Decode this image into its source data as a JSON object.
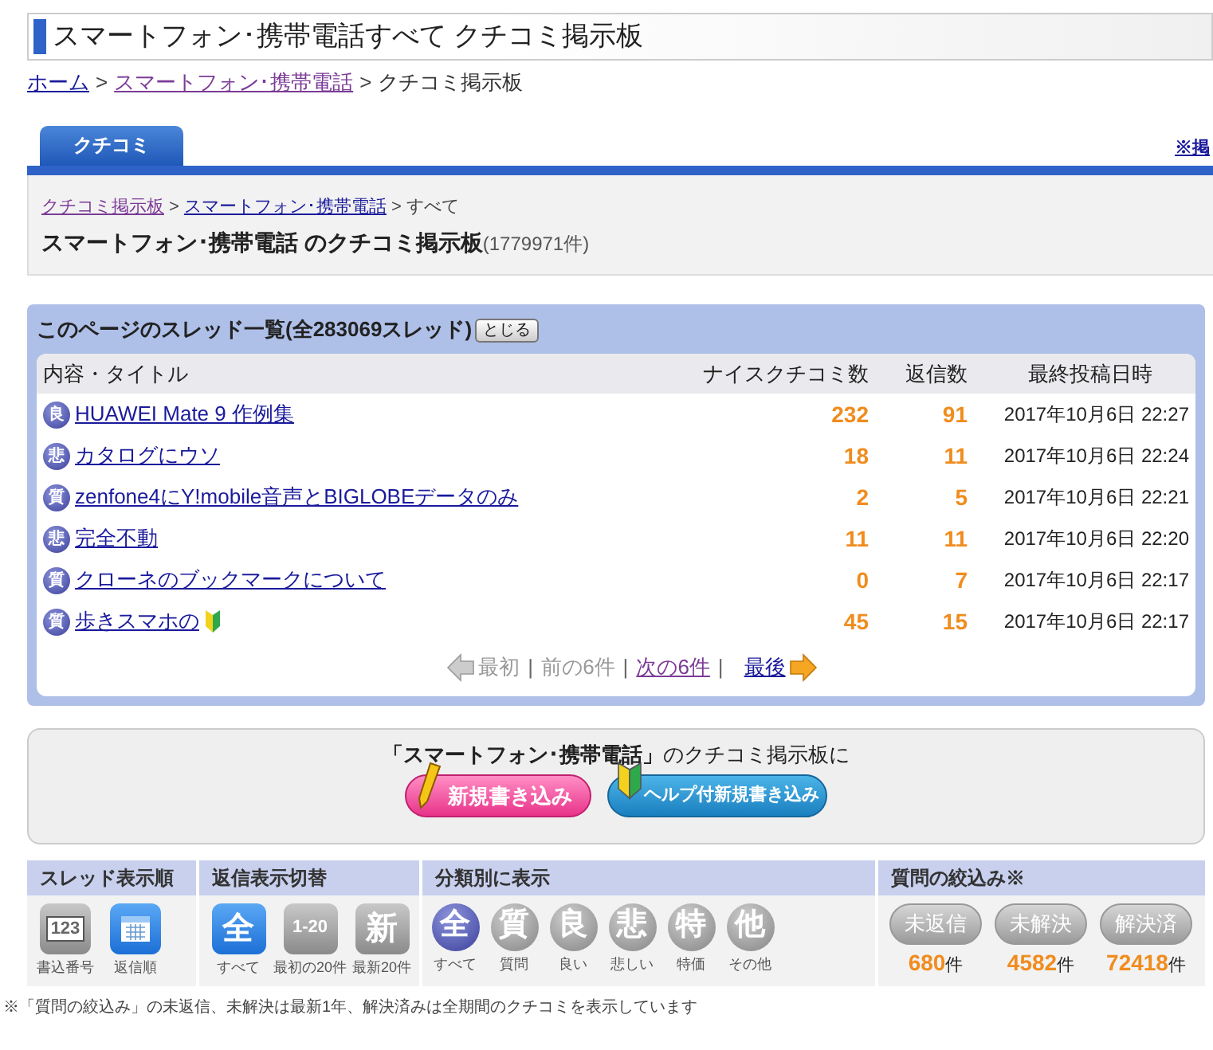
{
  "page_title": "スマートフォン･携帯電話すべて クチコミ掲示板",
  "breadcrumb": [
    {
      "label": "ホーム",
      "visited": false
    },
    {
      "separator": ">",
      "label": "スマートフォン･携帯電話",
      "visited": true
    },
    {
      "separator": ">",
      "label": "クチコミ掲示板",
      "link": false
    }
  ],
  "tabs": [
    {
      "label": "クチコミ",
      "selected": true
    }
  ],
  "side_link": "※掲",
  "board": {
    "breadcrumb": [
      {
        "label": "クチコミ掲示板",
        "link": true
      },
      {
        "separator": ">",
        "label": "スマートフォン･携帯電話",
        "link": true
      },
      {
        "separator": ">",
        "label": "すべて",
        "link": false
      }
    ],
    "heading": "スマートフォン･携帯電話 のクチコミ掲示板",
    "count": "(1779971件)"
  },
  "thread_list": {
    "title": "このページのスレッド一覧(全283069スレッド)",
    "close_button": "とじる",
    "columns": [
      "内容・タイトル",
      "ナイスクチコミ数",
      "返信数",
      "最終投稿日時"
    ],
    "rows": [
      {
        "badge": "良",
        "title": "HUAWEI Mate 9 作例集",
        "nice": "232",
        "replies": "91",
        "date": "2017年10月6日 22:27",
        "beginner": false
      },
      {
        "badge": "悲",
        "title": "カタログにウソ",
        "nice": "18",
        "replies": "11",
        "date": "2017年10月6日 22:24",
        "beginner": false
      },
      {
        "badge": "質",
        "title": "zenfone4にY!mobile音声とBIGLOBEデータのみ",
        "nice": "2",
        "replies": "5",
        "date": "2017年10月6日 22:21",
        "beginner": false
      },
      {
        "badge": "悲",
        "title": "完全不動",
        "nice": "11",
        "replies": "11",
        "date": "2017年10月6日 22:20",
        "beginner": false
      },
      {
        "badge": "質",
        "title": "クローネのブックマークについて",
        "nice": "0",
        "replies": "7",
        "date": "2017年10月6日 22:17",
        "beginner": false
      },
      {
        "badge": "質",
        "title": "歩きスマホの",
        "nice": "45",
        "replies": "15",
        "date": "2017年10月6日 22:17",
        "beginner": true
      }
    ],
    "pager": [
      {
        "label": "最初",
        "disabled": true,
        "kind": "first"
      },
      {
        "separator": "|",
        "label": "前の6件",
        "disabled": true,
        "kind": "prev"
      },
      {
        "separator": "|",
        "label": "次の6件",
        "disabled": false,
        "kind": "next"
      },
      {
        "separator": "|",
        "label": "最後",
        "disabled": false,
        "kind": "last"
      }
    ]
  },
  "post_box": {
    "text": "**「スマートフォン･携帯電話」**のクチコミ掲示板に",
    "buttons": [
      {
        "label": "新規書き込み",
        "kind": "pencil"
      },
      {
        "label": "ヘルプ付新規書き込み",
        "kind": "beginner"
      }
    ]
  },
  "filters": [
    {
      "title": "スレッド表示順",
      "kind": "icon",
      "items": [
        {
          "kind": "number",
          "icon": "123",
          "label": "書込番号",
          "selected": false
        },
        {
          "kind": "calendar",
          "label": "返信順",
          "selected": true
        }
      ]
    },
    {
      "title": "返信表示切替",
      "kind": "square",
      "items": [
        {
          "icon": "全",
          "label": "すべて",
          "selected": true
        },
        {
          "icon": "1-20",
          "label": "最初の20件",
          "selected": false
        },
        {
          "icon": "新",
          "label": "最新20件",
          "selected": false
        }
      ]
    },
    {
      "title": "分類別に表示",
      "kind": "circle",
      "items": [
        {
          "icon": "全",
          "label": "すべて",
          "selected": true
        },
        {
          "icon": "質",
          "label": "質問",
          "selected": false
        },
        {
          "icon": "良",
          "label": "良い",
          "selected": false
        },
        {
          "icon": "悲",
          "label": "悲しい",
          "selected": false
        },
        {
          "icon": "特",
          "label": "特価",
          "selected": false
        },
        {
          "icon": "他",
          "label": "その他",
          "selected": false
        }
      ]
    },
    {
      "title": "質問の絞込み※",
      "kind": "pill",
      "items": [
        {
          "icon": "未返信",
          "count": "680",
          "unit": "件"
        },
        {
          "icon": "未解決",
          "count": "4582",
          "unit": "件"
        },
        {
          "icon": "解決済",
          "count": "72418",
          "unit": "件"
        }
      ]
    }
  ],
  "note": "※「質問の絞込み」の未返信、未解決は最新1年、解決済みは全期間のクチコミを表示しています"
}
